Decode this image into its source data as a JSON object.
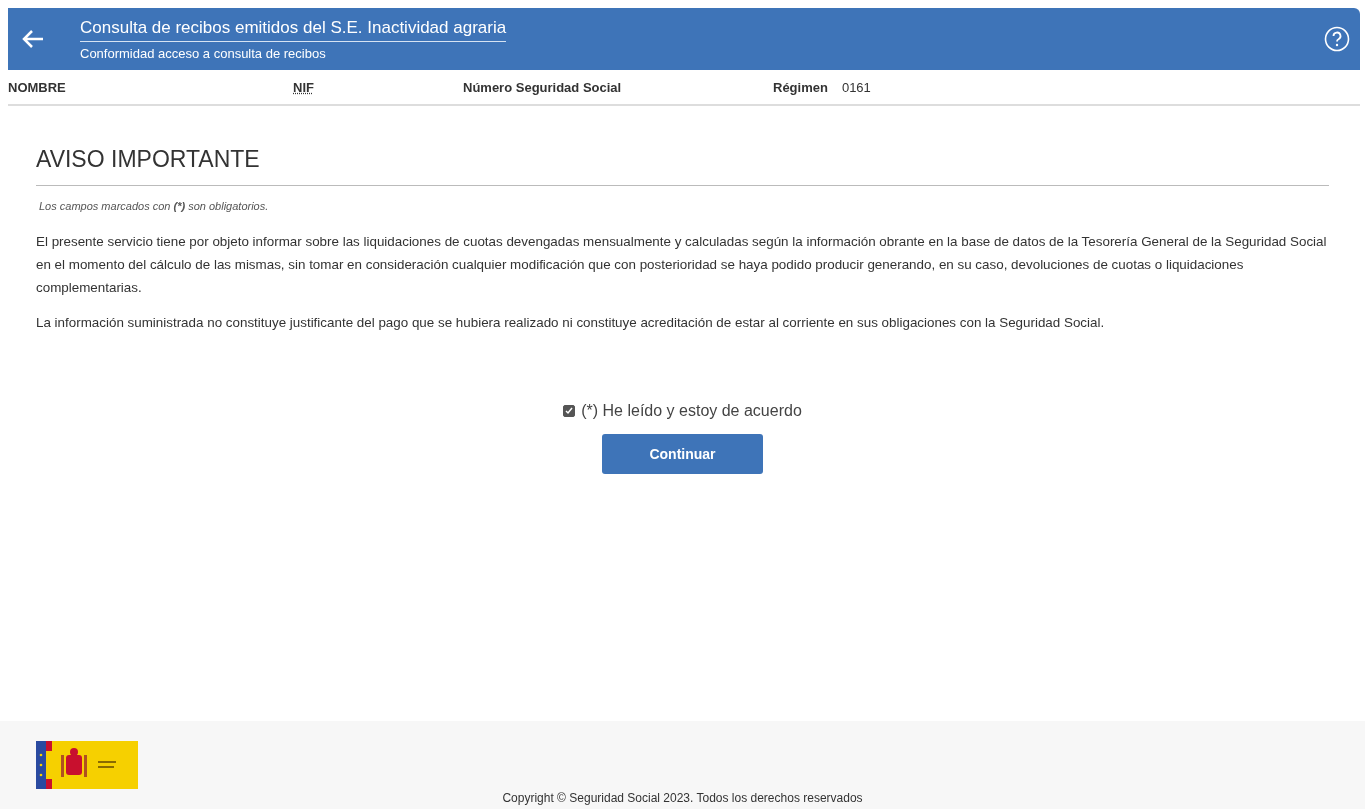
{
  "header": {
    "title": "Consulta de recibos emitidos del S.E. Inactividad agraria",
    "subtitle": "Conformidad acceso a consulta de recibos"
  },
  "info_bar": [
    {
      "label": "NOMBRE",
      "kind": "plain"
    },
    {
      "label": "NIF",
      "kind": "abbr"
    },
    {
      "label": "Número Seguridad Social",
      "kind": "plain"
    },
    {
      "label": "Régimen",
      "kind": "plain",
      "value": "0161"
    }
  ],
  "section_title": "AVISO IMPORTANTE",
  "required_note": "Los campos marcados con **(*)** son obligatorios.",
  "paragraphs": [
    "El presente servicio tiene por objeto informar sobre las liquidaciones de cuotas devengadas mensualmente y calculadas según la información obrante en la base de datos de la Tesorería General de la Seguridad Social en el momento del cálculo de las mismas, sin tomar en consideración cualquier modificación que con posterioridad se haya podido producir generando, en su caso, devoluciones de cuotas o liquidaciones complementarias.",
    "La información suministrada no constituye justificante del pago que se hubiera realizado ni constituye acreditación de estar al corriente en sus obligaciones con la Seguridad Social."
  ],
  "agreement": {
    "label": "(*) He leído y estoy de acuerdo",
    "checked": true
  },
  "button": "Continuar",
  "footer": {
    "copyright": "Copyright © Seguridad Social 2023. Todos los derechos reservados"
  }
}
